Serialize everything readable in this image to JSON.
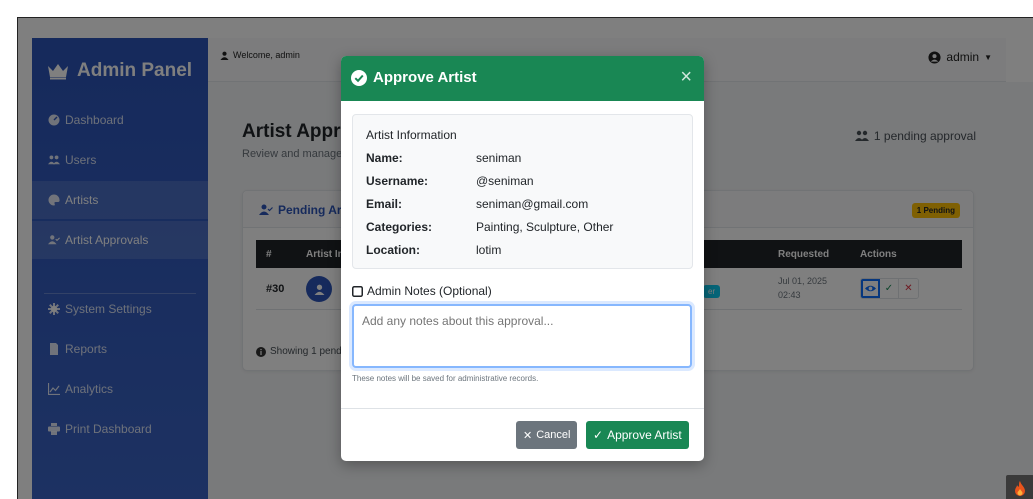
{
  "sidebar": {
    "brand": "Admin Panel",
    "items": [
      {
        "label": "Dashboard"
      },
      {
        "label": "Users"
      },
      {
        "label": "Artists"
      },
      {
        "label": "Artist Approvals"
      },
      {
        "label": "System Settings"
      },
      {
        "label": "Reports"
      },
      {
        "label": "Analytics"
      },
      {
        "label": "Print Dashboard"
      }
    ]
  },
  "topbar": {
    "welcome": "Welcome, admin",
    "user": "admin"
  },
  "page": {
    "title": "Artist Approvals",
    "subtitle": "Review and manage artist applications",
    "pending_summary": "1 pending approval"
  },
  "card": {
    "title": "Pending Artist Applications",
    "badge": "1 Pending",
    "columns": [
      "#",
      "Artist Info",
      "Requested",
      "Actions"
    ],
    "row": {
      "id": "#30",
      "badge": "er",
      "requested_date": "Jul 01, 2025",
      "requested_time": "02:43"
    },
    "showing": "Showing 1 pending application"
  },
  "modal": {
    "title": "Approve Artist",
    "close": "×",
    "info_title": "Artist Information",
    "fields": [
      {
        "key": "Name:",
        "value": "seniman"
      },
      {
        "key": "Username:",
        "value": "@seniman"
      },
      {
        "key": "Email:",
        "value": "seniman@gmail.com"
      },
      {
        "key": "Categories:",
        "value": "Painting, Sculpture, Other"
      },
      {
        "key": "Location:",
        "value": "lotim"
      }
    ],
    "notes_label": "Admin Notes (Optional)",
    "notes_placeholder": "Add any notes about this approval...",
    "notes_help": "These notes will be saved for administrative records.",
    "cancel_label": "Cancel",
    "approve_label": "Approve Artist"
  },
  "colors": {
    "sidebar": "#2c54b8",
    "modal_header": "#198754",
    "badge_warning": "#ffc107",
    "badge_info": "#0dcaf0",
    "cancel": "#6c757d"
  }
}
